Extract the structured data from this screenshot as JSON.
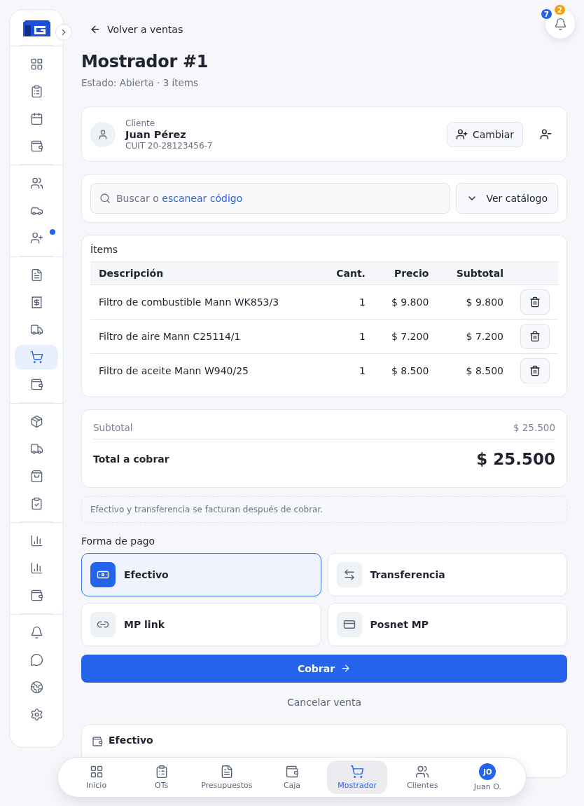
{
  "sidebar": {
    "groups": [
      {
        "items": [
          {
            "selected": false
          },
          {
            "selected": false
          },
          {
            "selected": false
          },
          {
            "selected": false
          }
        ]
      },
      {
        "items": [
          {
            "selected": false
          },
          {
            "selected": false
          },
          {
            "selected": false,
            "dot": true
          }
        ]
      },
      {
        "items": [
          {
            "selected": false
          },
          {
            "selected": false
          },
          {
            "selected": false
          },
          {
            "selected": true
          },
          {
            "selected": false
          }
        ]
      },
      {
        "items": [
          {
            "selected": false
          },
          {
            "selected": false
          },
          {
            "selected": false
          },
          {
            "selected": false
          }
        ]
      },
      {
        "items": [
          {
            "selected": false
          },
          {
            "selected": false
          },
          {
            "selected": false
          }
        ]
      },
      {
        "items": [
          {
            "selected": false
          },
          {
            "selected": false
          },
          {
            "selected": false
          },
          {
            "selected": false
          }
        ]
      }
    ]
  },
  "notifications": {
    "blue_count": "7",
    "orange_count": "2"
  },
  "back_link": "Volver a ventas",
  "title": "Mostrador #1",
  "subtitle": "Estado: Abierta · 3 ítems",
  "client": {
    "label": "Cliente",
    "name": "Juan Pérez",
    "cuit": "CUIT 20-28123456-7",
    "change_button": "Cambiar"
  },
  "search": {
    "placeholder": "Buscar o **escanear código**",
    "catalog_button": "Ver catálogo"
  },
  "items": {
    "title": "Ítems",
    "columns": [
      "Descripción",
      "Cant.",
      "Precio",
      "Subtotal"
    ],
    "rows": [
      {
        "description": "Filtro de combustible Mann WK853/3",
        "qty": "1",
        "price": "$ 9.800",
        "subtotal": "$ 9.800"
      },
      {
        "description": "Filtro de aire Mann C25114/1",
        "qty": "1",
        "price": "$ 7.200",
        "subtotal": "$ 7.200"
      },
      {
        "description": "Filtro de aceite Mann W940/25",
        "qty": "1",
        "price": "$ 8.500",
        "subtotal": "$ 8.500"
      }
    ]
  },
  "totals": {
    "subtotal_label": "Subtotal",
    "subtotal": "$ 25.500",
    "total_label": "Total a cobrar",
    "total": "$ 25.500"
  },
  "note": "Efectivo y transferencia se facturan después de cobrar.",
  "payment": {
    "title": "Forma de pago",
    "methods": [
      {
        "kind": "cash",
        "label": "Efectivo",
        "selected": true
      },
      {
        "kind": "transfer",
        "label": "Transferencia",
        "selected": false
      },
      {
        "kind": "link",
        "label": "MP link",
        "selected": false
      },
      {
        "kind": "card",
        "label": "Posnet MP",
        "selected": false
      }
    ]
  },
  "charge_button": "Cobrar",
  "cancel_link": "Cancelar venta",
  "method_card": {
    "title": "Efectivo"
  },
  "bottom_nav": [
    {
      "kind": "home",
      "label": "Inicio",
      "selected": false
    },
    {
      "kind": "orders",
      "label": "OTs",
      "selected": false
    },
    {
      "kind": "quotes",
      "label": "Presupuestos",
      "selected": false
    },
    {
      "kind": "cash",
      "label": "Caja",
      "selected": false
    },
    {
      "kind": "cart",
      "label": "Mostrador",
      "selected": true
    },
    {
      "kind": "clients",
      "label": "Clientes",
      "selected": false
    },
    {
      "kind": "avatar",
      "label": "Juan O.",
      "initials": "JO",
      "selected": false
    }
  ]
}
